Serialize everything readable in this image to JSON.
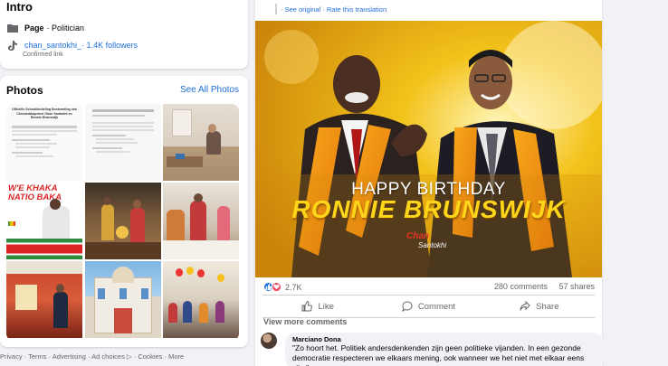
{
  "intro": {
    "title": "Intro",
    "page_label": "Page",
    "page_category": " · Politician",
    "tiktok_handle": "chan_santokhi_",
    "tiktok_followers": " · 1.4K followers",
    "tiktok_status": "Confirmed link"
  },
  "photos": {
    "title": "Photos",
    "see_all": "See All Photos",
    "tile1_text": "Officiële Schoolbindeling Bestemding van Cheeohalkaprinsi Ohan Santokhi en Ronnie Brunswijk",
    "tile5_text1": "W'E KHAKA",
    "tile5_text2": "NATIO BAKA"
  },
  "footer": {
    "links": "Privacy · Terms · Advertising · Ad choices ▷ · Cookies · More"
  },
  "post": {
    "translate_links": "· See original · Rate this translation",
    "image_line1": "HAPPY BIRTHDAY",
    "image_line2": "RONNIE BRUNSWIJK",
    "image_sig1": "Chan",
    "image_sig2": "Santokhi",
    "reaction_count": "2.7K",
    "comments_count": "280 comments",
    "shares_count": "57 shares",
    "like_label": "Like",
    "comment_label": "Comment",
    "share_label": "Share",
    "view_more": "View more comments"
  },
  "comment": {
    "author": "Marciano Dona",
    "text": "\"Zo hoort het. Politiek andersdenkenden zijn geen politieke vijanden. In een gezonde democratie respecteren we elkaars mening, ook wanneer we het niet met elkaar eens zijn.\""
  },
  "colors": {
    "link_blue": "#216fdb",
    "poster_gold": "#ffd51a",
    "page_bg": "#f0f2f5"
  }
}
